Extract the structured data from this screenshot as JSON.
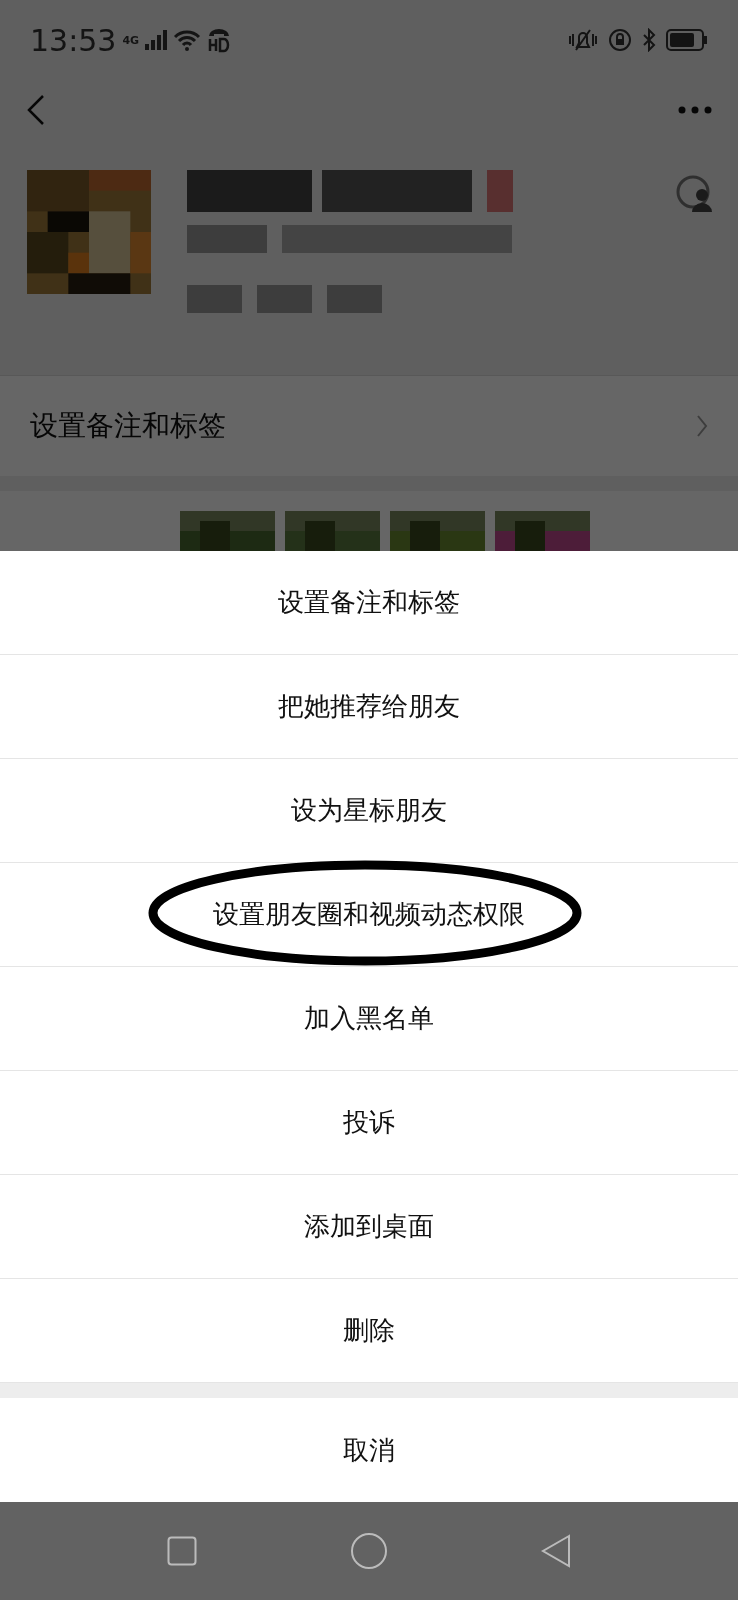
{
  "status_bar": {
    "time": "13:53",
    "network": "4G"
  },
  "rows": [
    {
      "label": "设置备注和标签"
    }
  ],
  "action_sheet": {
    "items": [
      {
        "label": "设置备注和标签",
        "circled": false
      },
      {
        "label": "把她推荐给朋友",
        "circled": false
      },
      {
        "label": "设为星标朋友",
        "circled": false
      },
      {
        "label": "设置朋友圈和视频动态权限",
        "circled": true
      },
      {
        "label": "加入黑名单",
        "circled": false
      },
      {
        "label": "投诉",
        "circled": false
      },
      {
        "label": "添加到桌面",
        "circled": false
      },
      {
        "label": "删除",
        "circled": false
      }
    ],
    "cancel": "取消"
  }
}
